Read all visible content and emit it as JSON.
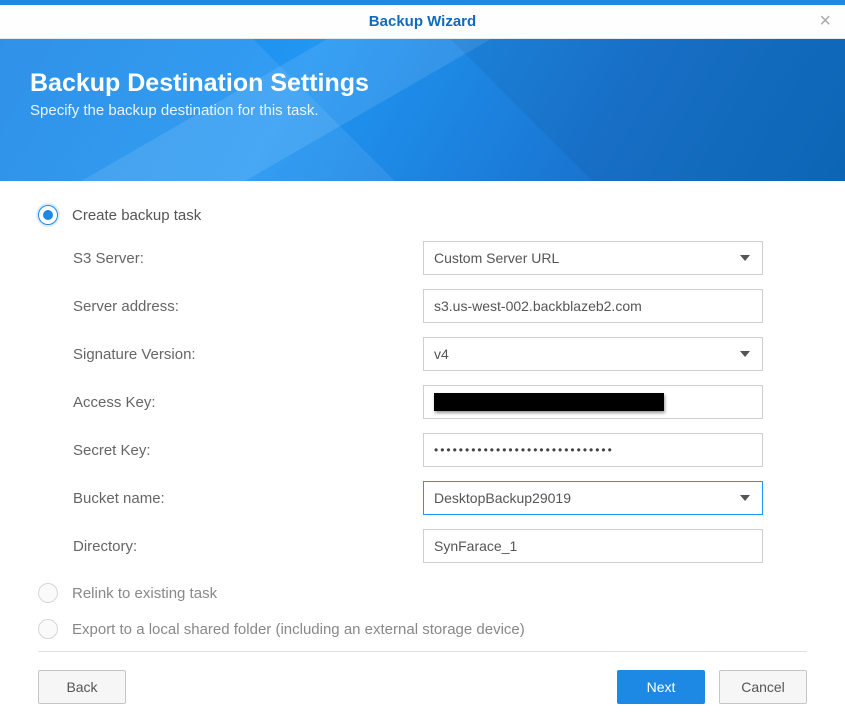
{
  "titlebar": {
    "title": "Backup Wizard"
  },
  "hero": {
    "heading": "Backup Destination Settings",
    "subheading": "Specify the backup destination for this task."
  },
  "options": {
    "create": "Create backup task",
    "relink": "Relink to existing task",
    "export": "Export to a local shared folder (including an external storage device)"
  },
  "form": {
    "s3server_label": "S3 Server:",
    "s3server_value": "Custom Server URL",
    "serveraddr_label": "Server address:",
    "serveraddr_value": "s3.us-west-002.backblazeb2.com",
    "sigver_label": "Signature Version:",
    "sigver_value": "v4",
    "accesskey_label": "Access Key:",
    "secretkey_label": "Secret Key:",
    "secretkey_value": "•••••••••••••••••••••••••••••",
    "bucket_label": "Bucket name:",
    "bucket_value": "DesktopBackup29019",
    "directory_label": "Directory:",
    "directory_value": "SynFarace_1"
  },
  "buttons": {
    "back": "Back",
    "next": "Next",
    "cancel": "Cancel"
  }
}
